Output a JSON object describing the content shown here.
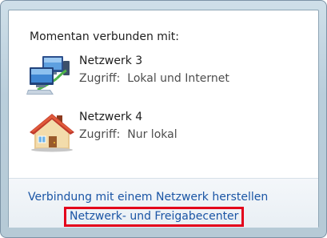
{
  "popup": {
    "heading": "Momentan verbunden mit:",
    "networks": [
      {
        "name": "Netzwerk 3",
        "access": "Zugriff:  Lokal und Internet",
        "icon": "network-computers-icon"
      },
      {
        "name": "Netzwerk 4",
        "access": "Zugriff:  Nur lokal",
        "icon": "home-network-icon"
      }
    ],
    "links": {
      "connect": "Verbindung mit einem Netzwerk herstellen",
      "network_center": "Netzwerk- und Freigabecenter"
    },
    "colors": {
      "link": "#1a55a5",
      "highlight_border": "#e3001b"
    }
  }
}
